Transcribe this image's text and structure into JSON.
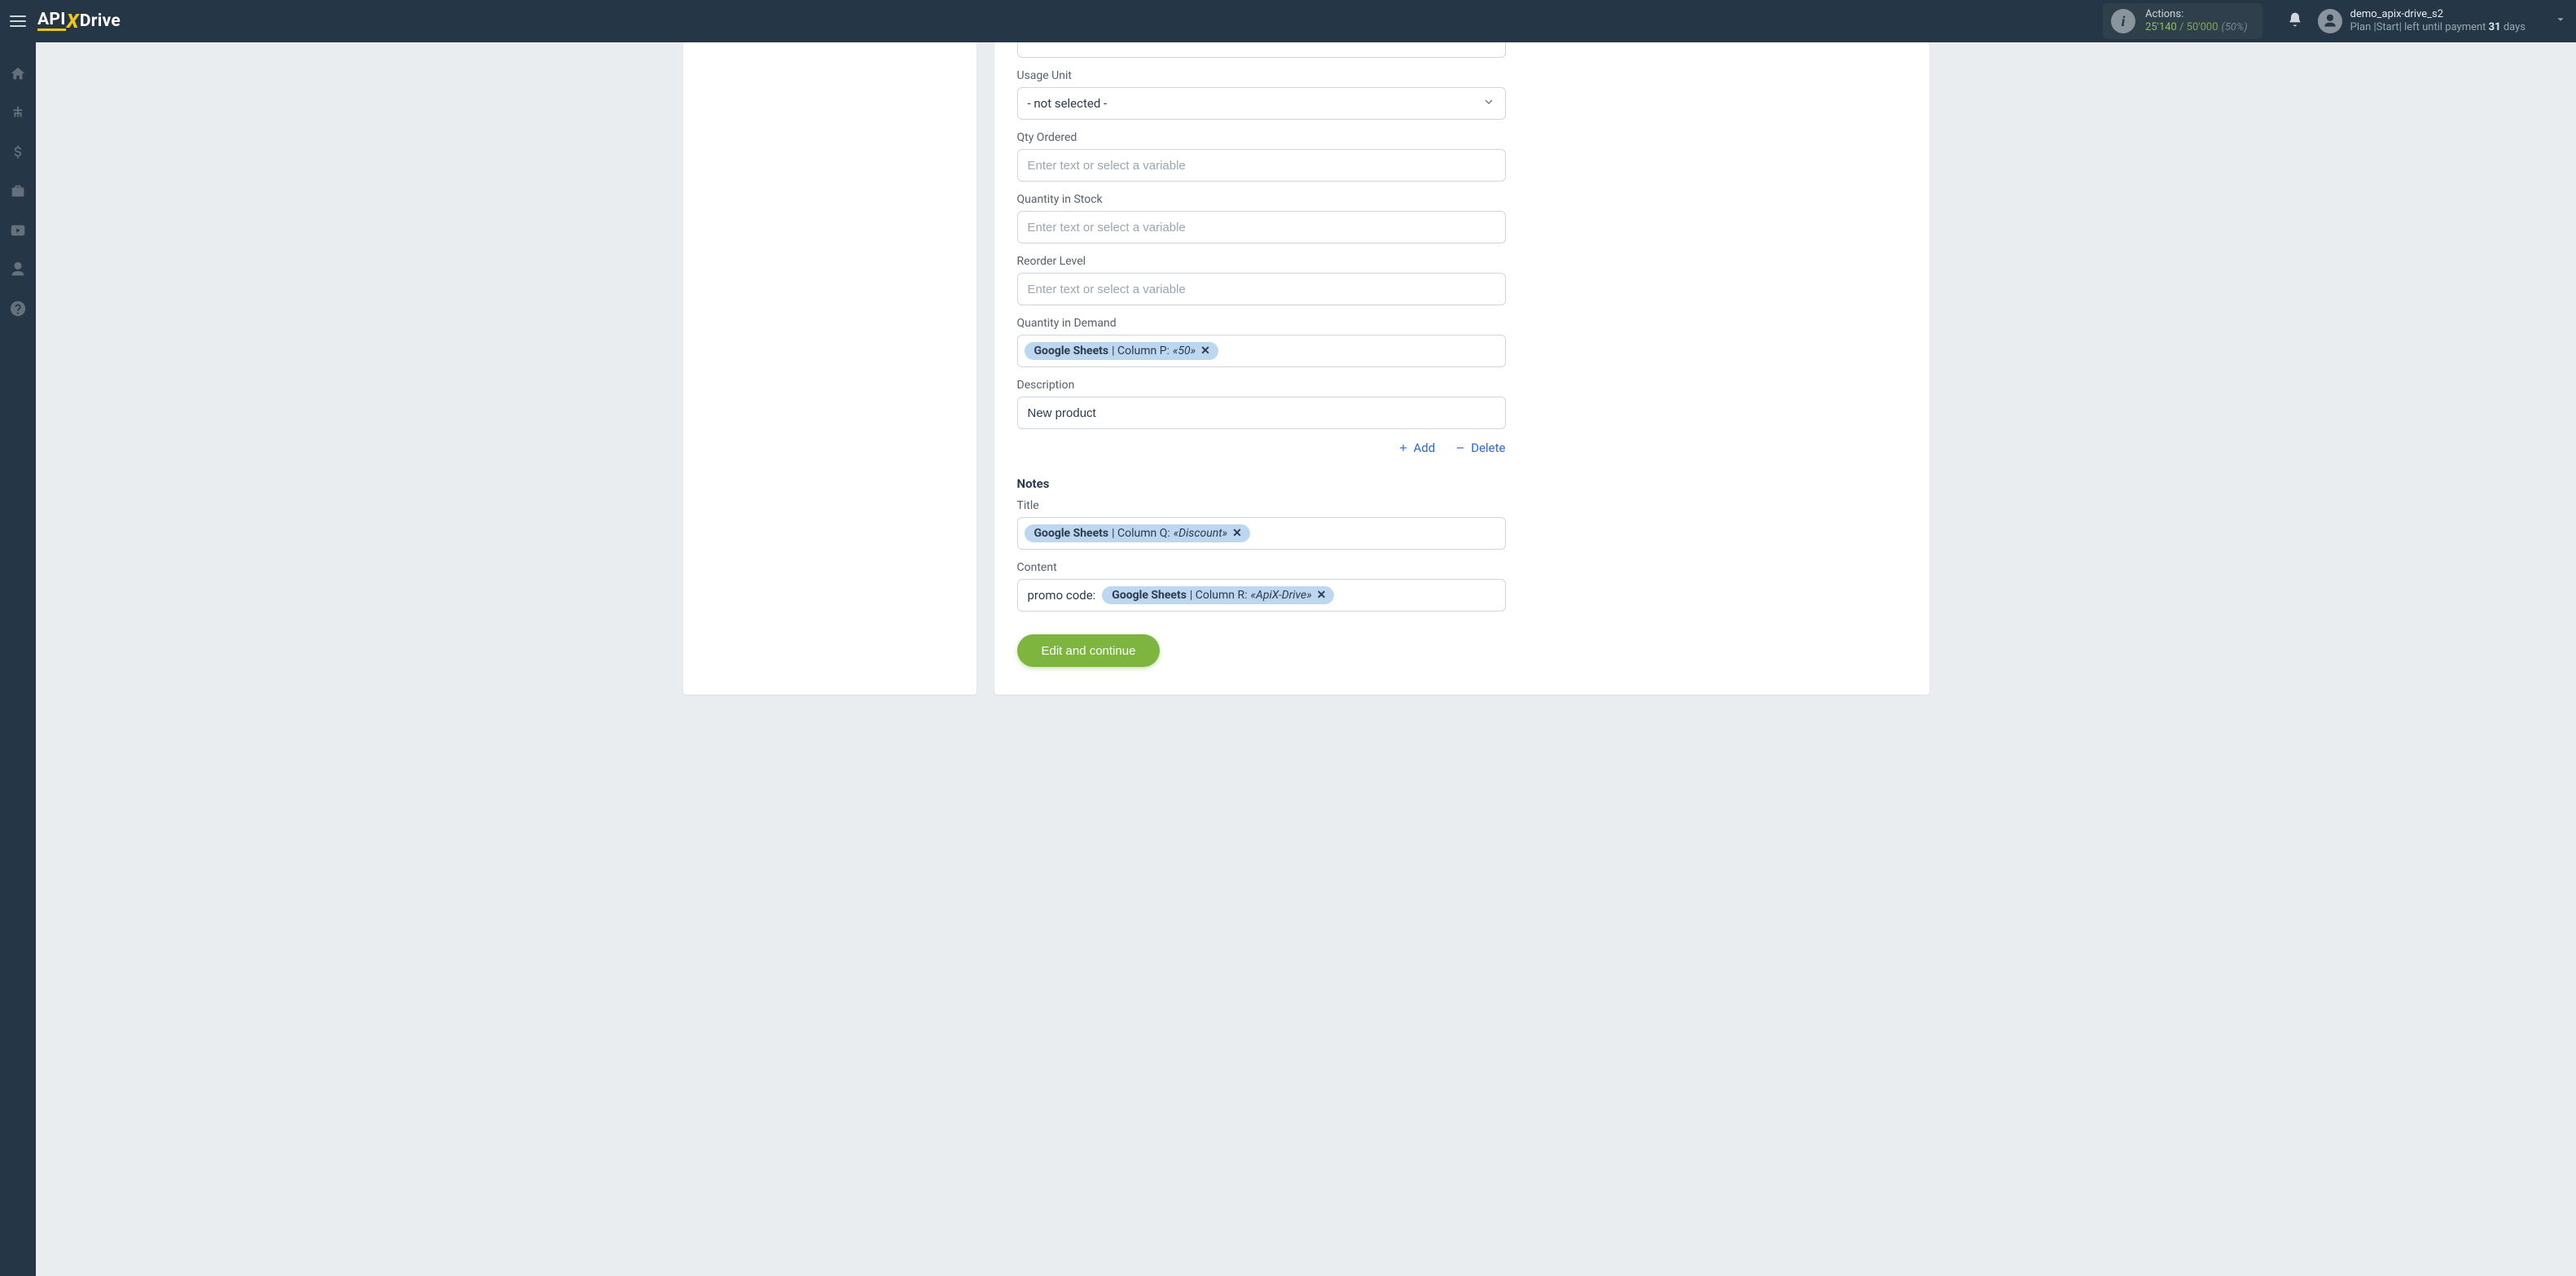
{
  "header": {
    "brand_api": "API",
    "brand_x": "X",
    "brand_drive": "Drive",
    "actions_label": "Actions:",
    "actions_used": "25'140",
    "actions_sep": " / ",
    "actions_cap": "50'000",
    "actions_pct": "(50%)",
    "user_name": "demo_apix-drive_s2",
    "plan_prefix": "Plan |",
    "plan_name": "Start",
    "plan_mid": "|  left until payment ",
    "plan_days_num": "31",
    "plan_days_unit": " days"
  },
  "form": {
    "usage_unit_label": "Usage Unit",
    "usage_unit_value": "- not selected -",
    "qty_ordered_label": "Qty Ordered",
    "qty_ordered_placeholder": "Enter text or select a variable",
    "qty_stock_label": "Quantity in Stock",
    "qty_stock_placeholder": "Enter text or select a variable",
    "reorder_label": "Reorder Level",
    "reorder_placeholder": "Enter text or select a variable",
    "qty_demand_label": "Quantity in Demand",
    "qty_demand_token_source": "Google Sheets",
    "qty_demand_token_col": " | Column P: ",
    "qty_demand_token_val": "«50»",
    "desc_label": "Description",
    "desc_value": "New product",
    "add_label": "Add",
    "delete_label": "Delete",
    "notes_heading": "Notes",
    "title_label": "Title",
    "title_token_source": "Google Sheets",
    "title_token_col": " | Column Q: ",
    "title_token_val": "«Discount»",
    "content_label": "Content",
    "content_prefix": "promo code:",
    "content_token_source": "Google Sheets",
    "content_token_col": " | Column R: ",
    "content_token_val": "«ApiX-Drive»",
    "cta": "Edit and continue"
  }
}
